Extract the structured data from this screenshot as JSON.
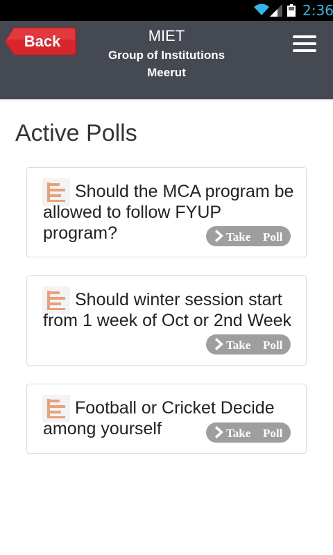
{
  "status_bar": {
    "time": "2:36",
    "icons": [
      "wifi-icon",
      "signal-icon",
      "battery-icon"
    ]
  },
  "header": {
    "back_label": "Back",
    "title_line1": "MIET",
    "title_line2": "Group of Institutions",
    "title_line3": "Meerut",
    "menu_icon": "hamburger-menu-icon"
  },
  "page": {
    "title": "Active Polls"
  },
  "polls": [
    {
      "question": "Should the MCA program be allowed to follow FYUP program?",
      "take_label_1": "Take",
      "take_label_2": "Poll"
    },
    {
      "question": "Should winter session start from 1 week of Oct or 2nd Week",
      "take_label_1": "Take",
      "take_label_2": "Poll"
    },
    {
      "question": "Football or Cricket Decide among yourself",
      "take_label_1": "Take",
      "take_label_2": "Poll"
    }
  ],
  "colors": {
    "header_bg": "#454a52",
    "back_button": "#d9252c",
    "status_time": "#33b5e5",
    "take_button": "#9e9e9e"
  }
}
